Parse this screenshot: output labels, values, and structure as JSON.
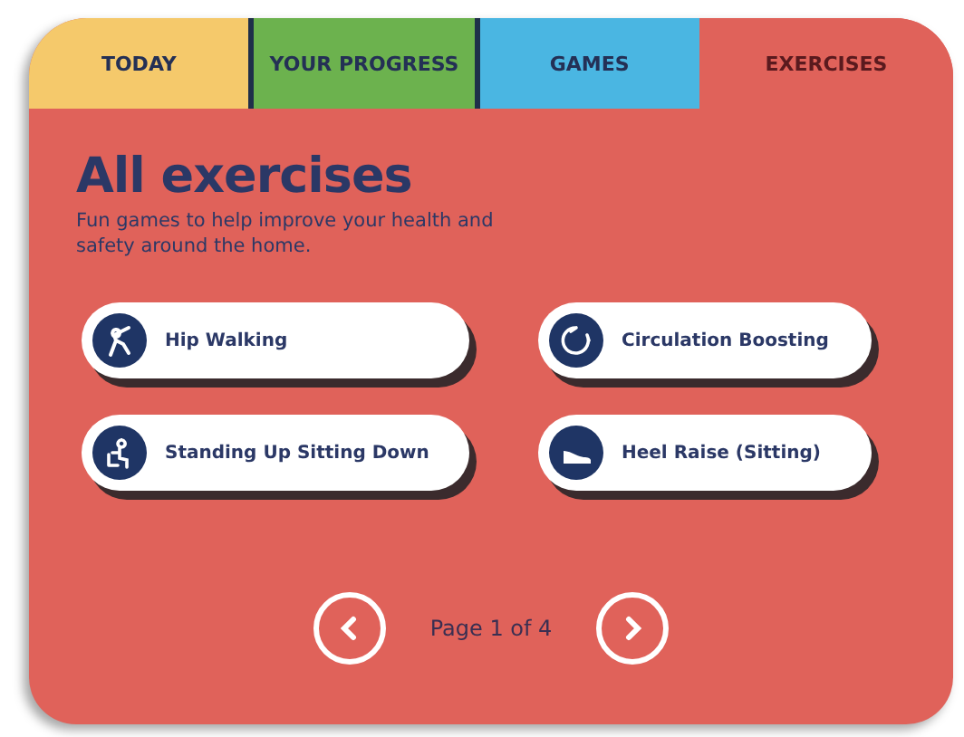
{
  "tabs": [
    {
      "label": "TODAY",
      "selected": false,
      "color": "#f5c96b"
    },
    {
      "label": "YOUR PROGRESS",
      "selected": false,
      "color": "#6cb24e"
    },
    {
      "label": "GAMES",
      "selected": false,
      "color": "#4ab6e2"
    },
    {
      "label": "EXERCISES",
      "selected": true,
      "color": "#e0625a"
    }
  ],
  "heading": "All exercises",
  "subtitle": "Fun games to help improve your health and safety around the home.",
  "exercises": [
    {
      "label": "Hip Walking",
      "kind": "walking"
    },
    {
      "label": "Circulation Boosting",
      "kind": "circulation"
    },
    {
      "label": "Standing Up Sitting Down",
      "kind": "sit-stand"
    },
    {
      "label": "Heel Raise (Sitting)",
      "kind": "shoe"
    }
  ],
  "pagination": {
    "label": "Page 1 of 4"
  }
}
